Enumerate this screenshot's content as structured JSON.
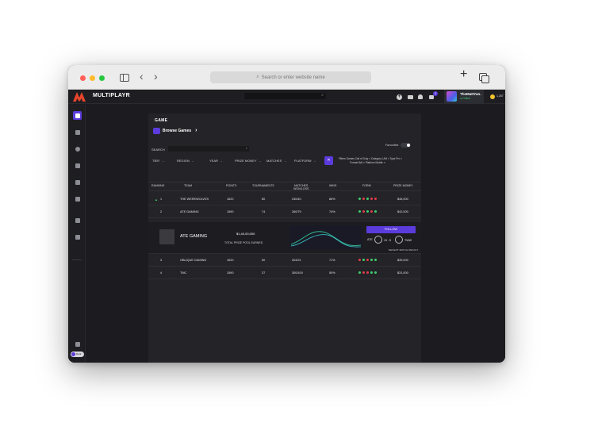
{
  "browser": {
    "url_placeholder": "Search or enter website name"
  },
  "app": {
    "logo_text": "MULTIPLAYR",
    "cart_badge": "2",
    "profile": {
      "name": "TheMattYan",
      "status": "● Online"
    },
    "coins": "1,267",
    "theme_toggle": "Dark"
  },
  "page": {
    "section_label": "GAME",
    "browse_label": "Browse Games",
    "search_label": "SEARCH",
    "favourites_label": "Favourites",
    "filters": {
      "tier": "TIER",
      "region": "REGION",
      "year": "YEAR",
      "prize_money": "PRIZE MONEY",
      "matches": "MATCHES",
      "platform": "PLATFORM"
    },
    "chips": {
      "filters_label": "Filters",
      "games": "Games Call of Duty ×",
      "category": "Category LAN ×",
      "type": "Type Pro ×",
      "format": "Format 8v8 ×",
      "platform": "Platform Mobile ×"
    }
  },
  "table": {
    "headers": {
      "ranking": "RANKING",
      "team": "TEAM",
      "points": "POINTS",
      "tournaments": "TOURNAMENTS",
      "matches": "MATCHES",
      "matches_sub": "WON/LOSS",
      "wins": "WINS",
      "form": "FORM",
      "prize": "PRIZE MONEY"
    },
    "rows": [
      {
        "rank": "1",
        "team": "THE WEREWOLVES",
        "points": "1620",
        "tournaments": "80",
        "matches": "240/40",
        "wins": "86%",
        "prize": "$45,000",
        "form": [
          "win",
          "loss",
          "win",
          "loss",
          "loss"
        ]
      },
      {
        "rank": "2",
        "team": "ATE GAMING",
        "points": "1590",
        "tournaments": "74",
        "matches": "260/79",
        "wins": "74%",
        "prize": "$42,000",
        "form": [
          "win",
          "loss",
          "win",
          "loss",
          "win"
        ]
      },
      {
        "rank": "3",
        "team": "OBLIQUE GAMING",
        "points": "1620",
        "tournaments": "50",
        "matches": "204/21",
        "wins": "71%",
        "prize": "$39,000",
        "form": [
          "loss",
          "win",
          "loss",
          "win",
          "win"
        ]
      },
      {
        "rank": "4",
        "team": "TMC",
        "points": "1590",
        "tournaments": "37",
        "matches": "300/100",
        "wins": "50%",
        "prize": "$31,000",
        "form": [
          "win",
          "loss",
          "loss",
          "win",
          "win"
        ]
      }
    ],
    "expanded": {
      "team": "ATE GAMING",
      "prize_value": "$1,40,00,000",
      "prize_label": "TOTAL PRIZE POOL EARNED",
      "follow": "FOLLOW",
      "vs_team_a": "ATE",
      "score": "10 : 5",
      "vs_team_b": "TWW",
      "match_link": "RECENT MATCH RESULT"
    }
  },
  "colors": {
    "accent": "#5b3bdc",
    "win": "#3ecf6e",
    "loss": "#e53b4a"
  }
}
